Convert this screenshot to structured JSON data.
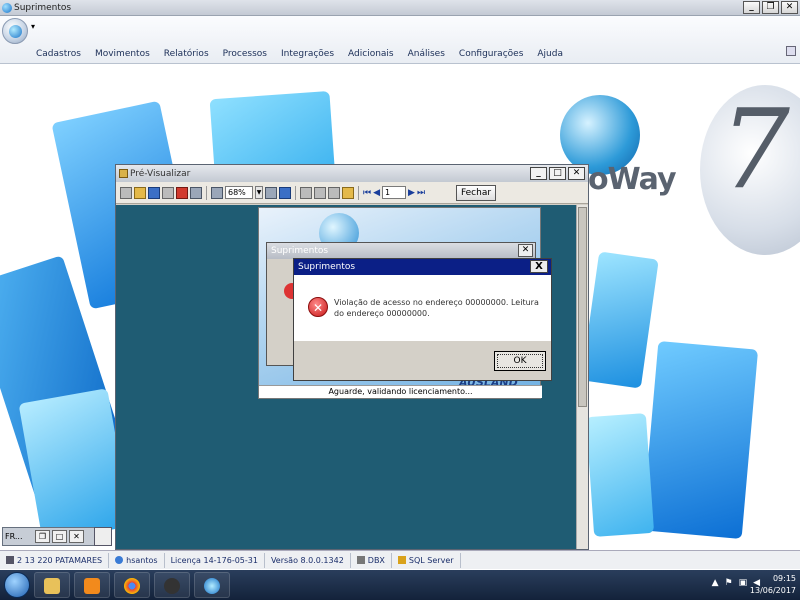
{
  "app": {
    "title": "Suprimentos",
    "qat": "▾"
  },
  "menu": [
    "Cadastros",
    "Movimentos",
    "Relatórios",
    "Processos",
    "Integrações",
    "Adicionais",
    "Análises",
    "Configurações",
    "Ajuda"
  ],
  "background": {
    "brand": "oWay",
    "version_digit": "7"
  },
  "mini_window": {
    "label": "FR..."
  },
  "preview": {
    "title": "Pré-Visualizar",
    "zoom": "68%",
    "page": "1",
    "close_label": "Fechar"
  },
  "splash": {
    "status": "Aguarde, validando licenciamento...",
    "brand": "AUSLAND"
  },
  "dialog_back": {
    "title": "Suprimentos"
  },
  "dialog": {
    "title": "Suprimentos",
    "message": "Violação de acesso no endereço 00000000. Leitura do endereço 00000000.",
    "ok_label": "OK",
    "close_label": "X"
  },
  "status": {
    "company": "2 13 220 PATAMARES",
    "user": "hsantos",
    "license": "Licença 14-176-05-31",
    "version": "Versão 8.0.0.1342",
    "db": "DBX",
    "server": "SQL Server"
  },
  "taskbar": {
    "time": "09:15",
    "date": "13/06/2017"
  }
}
